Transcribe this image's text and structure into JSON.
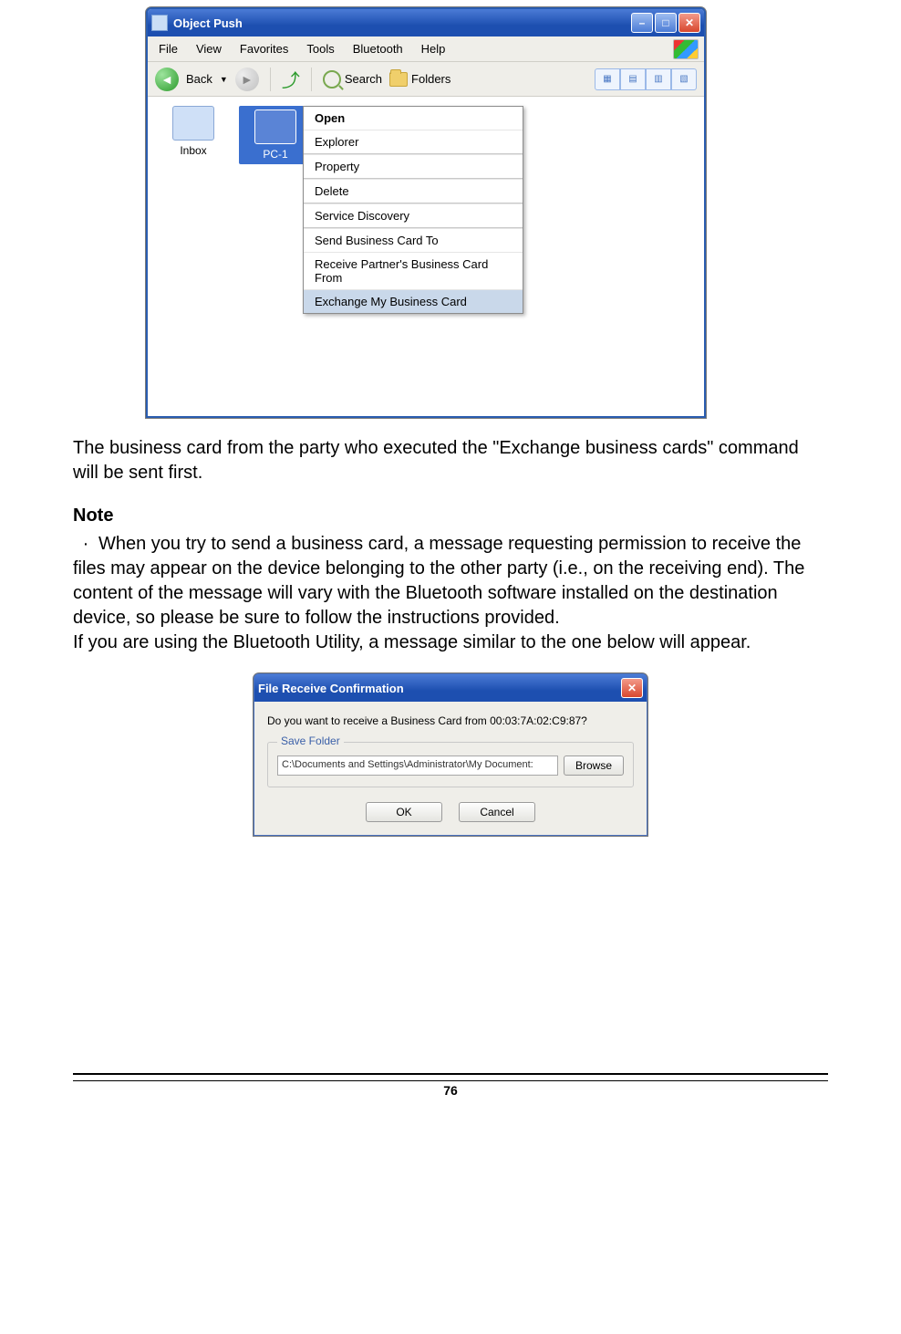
{
  "win1": {
    "title": "Object Push",
    "menus": [
      "File",
      "View",
      "Favorites",
      "Tools",
      "Bluetooth",
      "Help"
    ],
    "toolbar": {
      "back": "Back",
      "search": "Search",
      "folders": "Folders"
    },
    "items": [
      {
        "label": "Inbox"
      },
      {
        "label": "PC-1"
      }
    ],
    "context_menu": [
      "Open",
      "Explorer",
      "Property",
      "Delete",
      "Service Discovery",
      "Send Business Card To",
      "Receive Partner's Business Card From",
      "Exchange My Business Card"
    ]
  },
  "text": {
    "p1": "The business card from the party who executed the \"Exchange business cards\" command will be sent first.",
    "note_label": "Note",
    "bullet": "When you try to send a business card, a message requesting permission to receive the files may appear on the device belonging to the other party (i.e., on the receiving end). The content of the message will vary with the Bluetooth software installed on the destination device, so please be sure to follow the instructions provided.",
    "p_after": "If you are using the Bluetooth Utility, a message similar to the one below will appear."
  },
  "dlg": {
    "title": "File Receive Confirmation",
    "message": "Do you want to receive a Business Card from 00:03:7A:02:C9:87?",
    "legend": "Save Folder",
    "path": "C:\\Documents and Settings\\Administrator\\My Document:",
    "browse": "Browse",
    "ok": "OK",
    "cancel": "Cancel"
  },
  "page_number": "76"
}
